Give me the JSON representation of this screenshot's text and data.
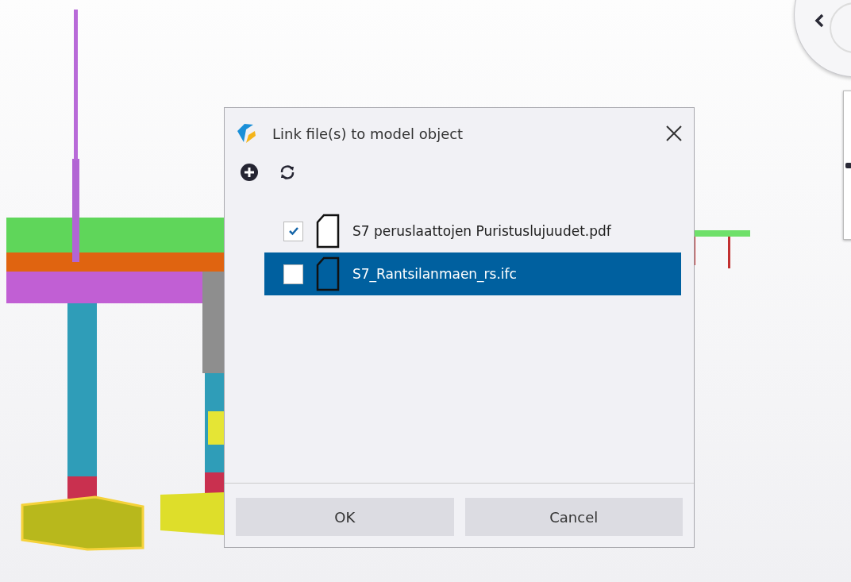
{
  "dialog": {
    "title": "Link file(s) to model object",
    "files": [
      {
        "name": "S7 peruslaattojen Puristuslujuudet.pdf",
        "checked": true,
        "selected": false
      },
      {
        "name": "S7_Rantsilanmaen_rs.ifc",
        "checked": false,
        "selected": true
      }
    ],
    "buttons": [
      "OK",
      "Cancel"
    ]
  }
}
